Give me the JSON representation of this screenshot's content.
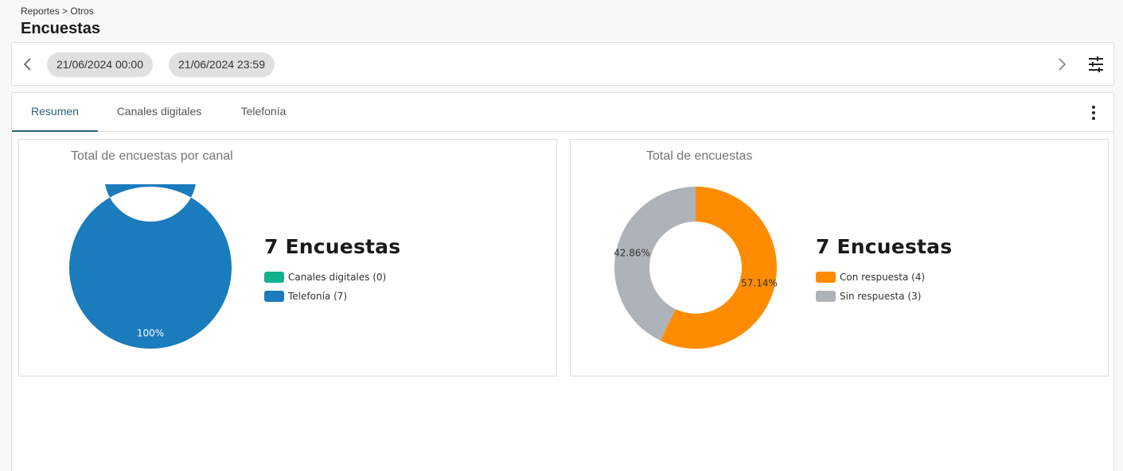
{
  "header": {
    "breadcrumb": "Reportes > Otros",
    "title": "Encuestas"
  },
  "toolbar": {
    "date_start": "21/06/2024 00:00",
    "date_end": "21/06/2024 23:59",
    "icons": {
      "prev": "chevron-left-icon",
      "next": "chevron-right-icon",
      "filter": "tune-icon"
    }
  },
  "tabs": [
    {
      "label": "Resumen",
      "active": true
    },
    {
      "label": "Canales digitales",
      "active": false
    },
    {
      "label": "Telefonía",
      "active": false
    }
  ],
  "colors": {
    "canales": "#13b08c",
    "telefonia": "#1a7bbd",
    "con": "#ff8c00",
    "sin": "#adb3b9",
    "accent": "#2f5f7f"
  },
  "chart_data": [
    {
      "type": "pie",
      "title": "Total de encuestas por canal",
      "total_label": "7 Encuestas",
      "series": [
        {
          "name": "Canales digitales",
          "value": 0,
          "color": "#13b08c",
          "legend": "Canales digitales (0)",
          "label": ""
        },
        {
          "name": "Telefonía",
          "value": 7,
          "color": "#1a7bbd",
          "legend": "Telefonía (7)",
          "label": "100%"
        }
      ]
    },
    {
      "type": "pie",
      "title": "Total de encuestas",
      "total_label": "7 Encuestas",
      "series": [
        {
          "name": "Con respuesta",
          "value": 4,
          "color": "#ff8c00",
          "legend": "Con respuesta (4)",
          "label": "57.14%"
        },
        {
          "name": "Sin respuesta",
          "value": 3,
          "color": "#adb3b9",
          "legend": "Sin respuesta (3)",
          "label": "42.86%"
        }
      ]
    }
  ]
}
